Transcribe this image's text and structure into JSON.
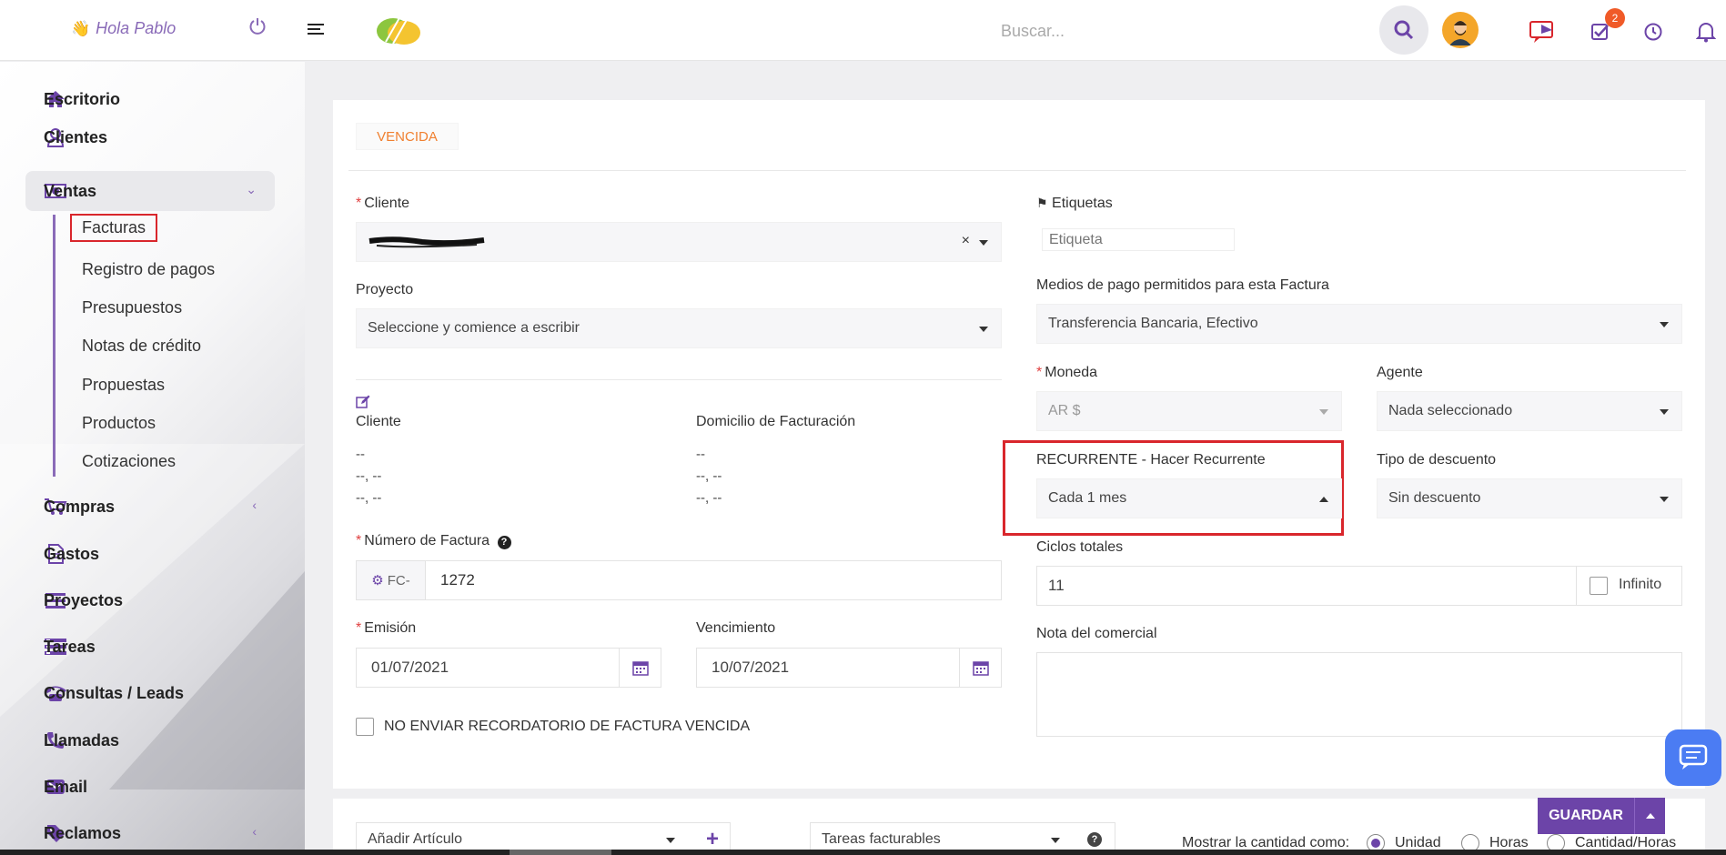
{
  "header": {
    "greeting": "Hola Pablo",
    "search_placeholder": "Buscar...",
    "notification_count": "2"
  },
  "sidebar": {
    "items": [
      {
        "label": "Escritorio",
        "icon": "home-icon"
      },
      {
        "label": "Clientes",
        "icon": "user-icon"
      },
      {
        "label": "Ventas",
        "icon": "money-icon"
      },
      {
        "label": "Compras",
        "icon": "cart-icon"
      },
      {
        "label": "Gastos",
        "icon": "file-icon"
      },
      {
        "label": "Proyectos",
        "icon": "bars-icon"
      },
      {
        "label": "Tareas",
        "icon": "tasks-icon"
      },
      {
        "label": "Consultas / Leads",
        "icon": "phone-icon"
      },
      {
        "label": "Llamadas",
        "icon": "call-icon"
      },
      {
        "label": "Email",
        "icon": "email-icon"
      },
      {
        "label": "Reclamos",
        "icon": "tag-icon"
      }
    ],
    "ventas_sub": [
      "Facturas",
      "Registro de pagos",
      "Presupuestos",
      "Notas de crédito",
      "Propuestas",
      "Productos",
      "Cotizaciones"
    ]
  },
  "invoice": {
    "status": "VENCIDA",
    "cliente_label": "Cliente",
    "proyecto_label": "Proyecto",
    "proyecto_placeholder": "Seleccione y comience a escribir",
    "cliente_col": "Cliente",
    "domicilio_col": "Domicilio de Facturación",
    "cliente_lines": [
      "--",
      "--, --",
      "--, --"
    ],
    "domicilio_lines": [
      "--",
      "--, --",
      "--, --"
    ],
    "numero_label": "Número de Factura",
    "numero_prefix": "FC-",
    "numero_value": "1272",
    "emision_label": "Emisión",
    "emision_value": "01/07/2021",
    "vencimiento_label": "Vencimiento",
    "vencimiento_value": "10/07/2021",
    "no_recordatorio_label": "NO ENVIAR RECORDATORIO DE FACTURA VENCIDA",
    "etiquetas_label": "Etiquetas",
    "etiqueta_placeholder": "Etiqueta",
    "medios_label": "Medios de pago permitidos para esta Factura",
    "medios_value": "Transferencia Bancaria, Efectivo",
    "moneda_label": "Moneda",
    "moneda_value": "AR $",
    "agente_label": "Agente",
    "agente_value": "Nada seleccionado",
    "recurrente_label": "RECURRENTE - Hacer Recurrente",
    "recurrente_value": "Cada 1 mes",
    "descuento_label": "Tipo de descuento",
    "descuento_value": "Sin descuento",
    "ciclos_label": "Ciclos totales",
    "ciclos_value": "11",
    "infinito_label": "Infinito",
    "nota_label": "Nota del comercial"
  },
  "footer": {
    "anadir_articulo": "Añadir Artículo",
    "tareas_facturables": "Tareas facturables",
    "mostrar_label": "Mostrar la cantidad como:",
    "opt_unidad": "Unidad",
    "opt_horas": "Horas",
    "opt_cantidad_horas": "Cantidad/Horas",
    "guardar": "GUARDAR"
  },
  "colors": {
    "accent": "#6c44a8",
    "status_orange": "#f08030",
    "highlight_red": "#d9262c",
    "chat_blue": "#4b7cf3"
  }
}
